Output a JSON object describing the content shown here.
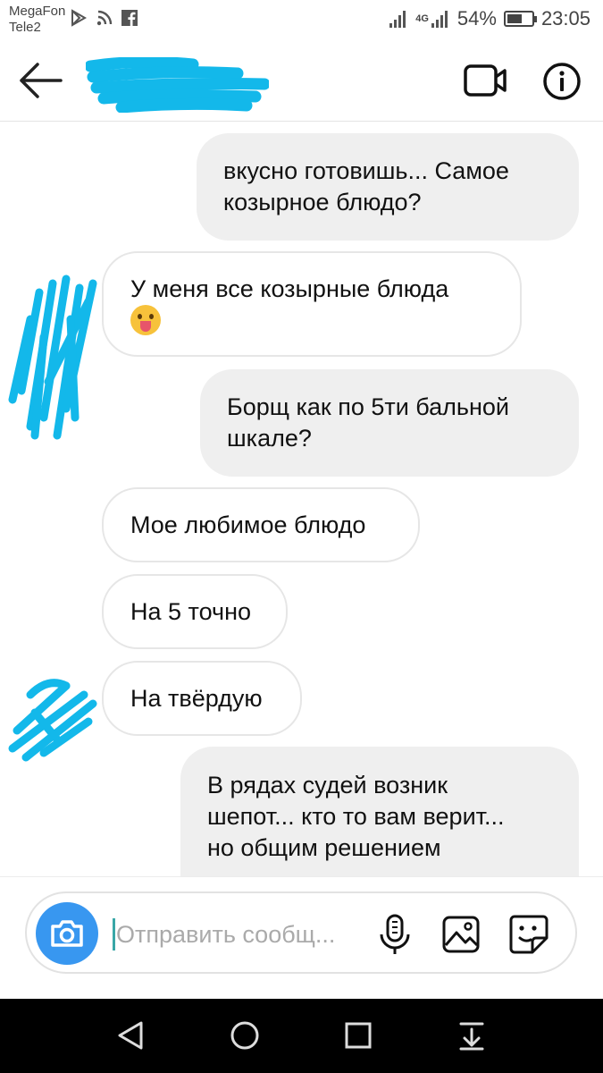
{
  "status_bar": {
    "carrier_1": "MegaFon",
    "carrier_2": "Tele2",
    "network": "4G",
    "battery": "54%",
    "time": "23:05"
  },
  "header": {
    "title_redacted": true
  },
  "messages": [
    {
      "direction": "outgoing",
      "lines": [
        "вкусно готовишь... Самое",
        "козырное блюдо?"
      ]
    },
    {
      "direction": "incoming",
      "lines": [
        "У меня все козырные блюда"
      ],
      "emoji": "tongue-face-emoji"
    },
    {
      "direction": "outgoing",
      "lines": [
        "Борщ как по 5ти бальной",
        "шкале?"
      ]
    },
    {
      "direction": "incoming",
      "lines": [
        "Мое любимое блюдо"
      ]
    },
    {
      "direction": "incoming",
      "lines": [
        "На 5 точно"
      ]
    },
    {
      "direction": "incoming",
      "lines": [
        "На твёрдую"
      ]
    },
    {
      "direction": "outgoing",
      "lines": [
        "В рядах судей возник",
        "шепот... кто то вам верит...",
        "но общим решением"
      ]
    }
  ],
  "composer": {
    "placeholder": "Отправить сообщ..."
  },
  "colors": {
    "accent_blue": "#3897f0",
    "outgoing_bubble": "#efefef",
    "redaction": "#13b8ea",
    "nav_bar": "#000000"
  }
}
